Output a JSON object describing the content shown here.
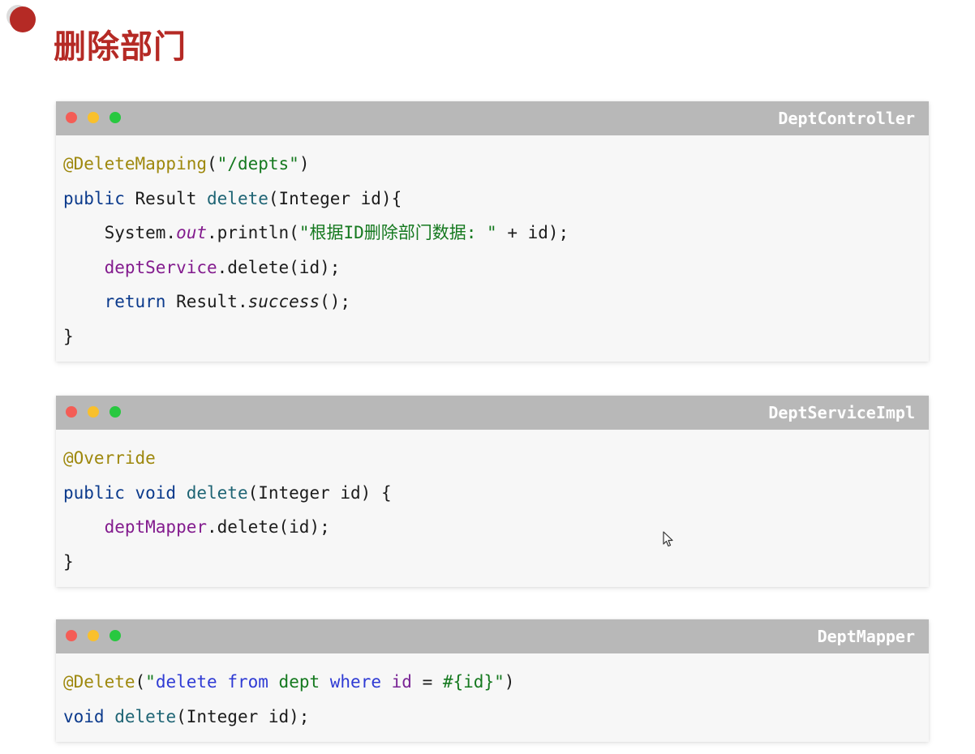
{
  "slide": {
    "title": "删除部门"
  },
  "windows": [
    {
      "title": "DeptController",
      "lines": [
        [
          {
            "t": "@DeleteMapping",
            "c": "annotation"
          },
          {
            "t": "(",
            "c": "plain"
          },
          {
            "t": "\"/depts\"",
            "c": "string"
          },
          {
            "t": ")",
            "c": "plain"
          }
        ],
        [
          {
            "t": "public",
            "c": "keyword"
          },
          {
            "t": " Result ",
            "c": "plain"
          },
          {
            "t": "delete",
            "c": "method"
          },
          {
            "t": "(Integer id){",
            "c": "plain"
          }
        ],
        [
          {
            "t": "    System.",
            "c": "plain"
          },
          {
            "t": "out",
            "c": "italic-field"
          },
          {
            "t": ".println(",
            "c": "plain"
          },
          {
            "t": "\"根据ID删除部门数据: \"",
            "c": "string"
          },
          {
            "t": " + id);",
            "c": "plain"
          }
        ],
        [
          {
            "t": "    ",
            "c": "plain"
          },
          {
            "t": "deptService",
            "c": "field"
          },
          {
            "t": ".delete(id);",
            "c": "plain"
          }
        ],
        [
          {
            "t": "    ",
            "c": "plain"
          },
          {
            "t": "return",
            "c": "keyword"
          },
          {
            "t": " Result.",
            "c": "plain"
          },
          {
            "t": "success",
            "c": "italic"
          },
          {
            "t": "();",
            "c": "plain"
          }
        ],
        [
          {
            "t": "}",
            "c": "plain"
          }
        ]
      ]
    },
    {
      "title": "DeptServiceImpl",
      "lines": [
        [
          {
            "t": "@Override",
            "c": "annotation"
          }
        ],
        [
          {
            "t": "public void",
            "c": "keyword"
          },
          {
            "t": " ",
            "c": "plain"
          },
          {
            "t": "delete",
            "c": "method"
          },
          {
            "t": "(Integer id) {",
            "c": "plain"
          }
        ],
        [
          {
            "t": "    ",
            "c": "plain"
          },
          {
            "t": "deptMapper",
            "c": "field"
          },
          {
            "t": ".delete(id);",
            "c": "plain"
          }
        ],
        [
          {
            "t": "}",
            "c": "plain"
          }
        ]
      ]
    },
    {
      "title": "DeptMapper",
      "lines": [
        [
          {
            "t": "@Delete",
            "c": "annotation"
          },
          {
            "t": "(",
            "c": "plain"
          },
          {
            "t": "\"",
            "c": "string"
          },
          {
            "t": "delete from ",
            "c": "sql"
          },
          {
            "t": "dept",
            "c": "sqlid"
          },
          {
            "t": " where ",
            "c": "sql"
          },
          {
            "t": "id",
            "c": "param"
          },
          {
            "t": " = ",
            "c": "plain"
          },
          {
            "t": "#{id}",
            "c": "sqlid"
          },
          {
            "t": "\"",
            "c": "string"
          },
          {
            "t": ")",
            "c": "plain"
          }
        ],
        [
          {
            "t": "void",
            "c": "keyword"
          },
          {
            "t": " ",
            "c": "plain"
          },
          {
            "t": "delete",
            "c": "method"
          },
          {
            "t": "(Integer id);",
            "c": "plain"
          }
        ]
      ]
    }
  ],
  "icons": {
    "slide_bullet": "red-circle-bullet",
    "traffic_lights": [
      "close-dot",
      "minimize-dot",
      "maximize-dot"
    ],
    "pointer": "mouse-cursor-icon"
  },
  "colors": {
    "title": "#b52a25",
    "titlebar": "#b8b8b8",
    "code_bg": "#f7f7f7"
  }
}
